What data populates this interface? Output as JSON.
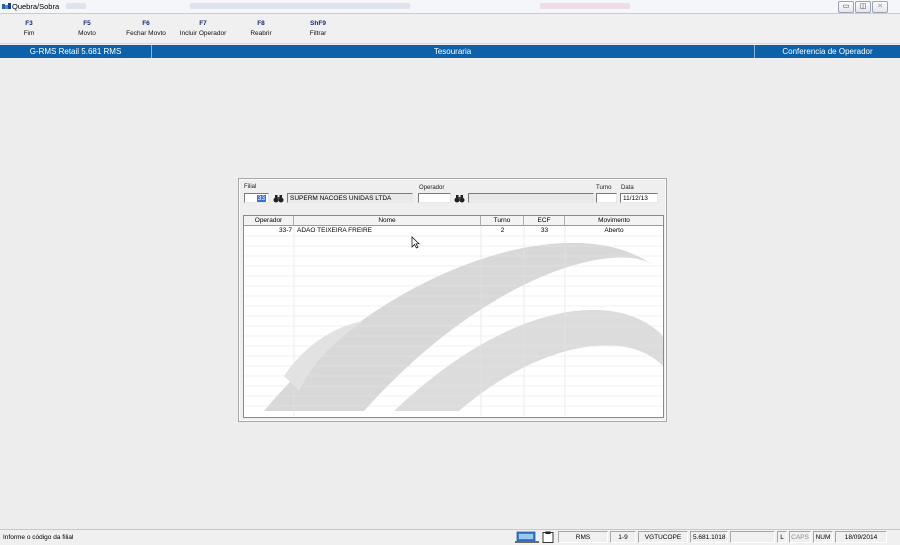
{
  "window": {
    "title": "Quebra/Sobra",
    "controls": [
      "minimize",
      "restore",
      "close"
    ]
  },
  "fkeys": [
    {
      "key": "F3",
      "label": "Fim"
    },
    {
      "key": "F5",
      "label": "Movto"
    },
    {
      "key": "F6",
      "label": "Fechar Movto"
    },
    {
      "key": "F7",
      "label": "Incluir Operador"
    },
    {
      "key": "F8",
      "label": "Reabrir"
    },
    {
      "key": "ShF9",
      "label": "Filtrar"
    }
  ],
  "header": {
    "left": "G-RMS Retail 5.681 RMS",
    "center": "Tesouraria",
    "right": "Conferencia de Operador"
  },
  "form": {
    "filial_label": "Filial",
    "filial_value": "33",
    "filial_name": "SUPERM NACOES UNIDAS LTDA",
    "operador_label": "Operador",
    "operador_value": "",
    "operador_name": "",
    "turno_label": "Turno",
    "turno_value": "",
    "data_label": "Data",
    "data_value": "11/12/13"
  },
  "grid": {
    "columns": [
      "Operador",
      "Nome",
      "Turno",
      "ECF",
      "Movimento"
    ],
    "rows": [
      {
        "operador": "33-7",
        "nome": "ADAO TEIXEIRA FREIRE",
        "turno": "2",
        "ecf": "33",
        "movimento": "Aberto"
      }
    ]
  },
  "status": {
    "message": "Informe o código da filial",
    "system": "RMS",
    "range": "1-9",
    "program": "VGTUCOPE",
    "version": "5.681.1018",
    "ind_l": "L",
    "ind_caps": "CAPS",
    "ind_num": "NUM",
    "date": "18/09/2014"
  },
  "colors": {
    "header_bar": "#0c61a9",
    "selection": "#3a6fd8"
  }
}
